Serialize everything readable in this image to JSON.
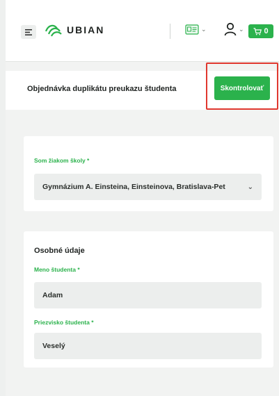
{
  "header": {
    "logo_text": "UBIAN",
    "cart_count": "0"
  },
  "titlebar": {
    "title": "Objednávka duplikátu preukazu študenta",
    "check_button": "Skontrolovať"
  },
  "school_section": {
    "label": "Som žiakom školy *",
    "selected_value": "Gymnázium A. Einsteina, Einsteinova, Bratislava-Pet"
  },
  "personal_section": {
    "heading": "Osobné údaje",
    "first_name_label": "Meno študenta *",
    "first_name_value": "Adam",
    "last_name_label": "Priezvisko študenta *",
    "last_name_value": "Veselý"
  },
  "colors": {
    "accent": "#2bb24c",
    "highlight": "#e0382f"
  },
  "icons": [
    "hamburger-icon",
    "ubian-logo-icon",
    "id-card-icon",
    "user-icon",
    "cart-icon",
    "chevron-down-icon"
  ]
}
